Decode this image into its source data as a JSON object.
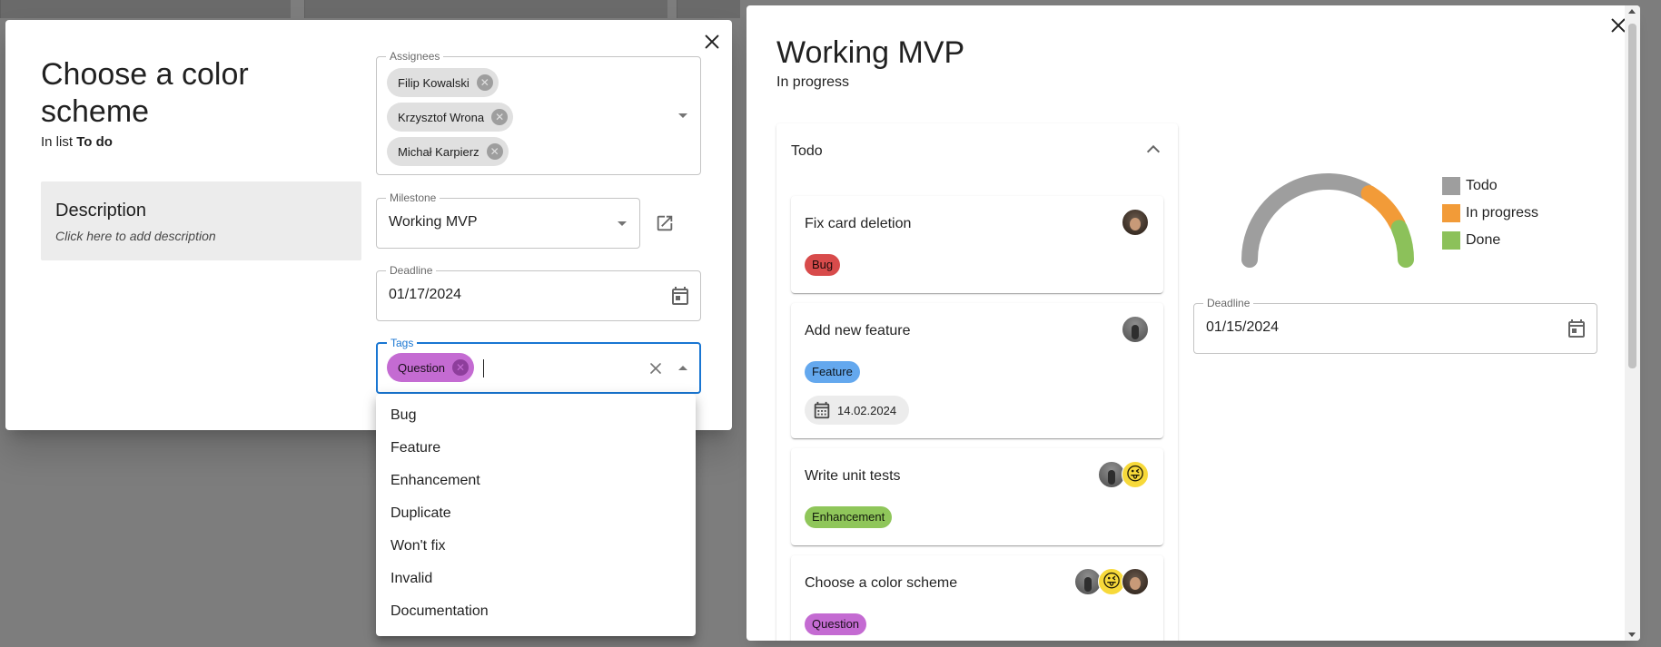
{
  "left_dialog": {
    "title": "Choose a color scheme",
    "in_list_prefix": "In list",
    "in_list_name": "To do",
    "description": {
      "title": "Description",
      "hint": "Click here to add description"
    },
    "assignees": {
      "label": "Assignees",
      "chips": [
        "Filip Kowalski",
        "Krzysztof Wrona",
        "Michał Karpierz"
      ]
    },
    "milestone": {
      "label": "Milestone",
      "value": "Working MVP"
    },
    "deadline": {
      "label": "Deadline",
      "value": "01/17/2024"
    },
    "tags": {
      "label": "Tags",
      "chips": [
        "Question"
      ],
      "options": [
        "Bug",
        "Feature",
        "Enhancement",
        "Duplicate",
        "Won't fix",
        "Invalid",
        "Documentation"
      ]
    }
  },
  "right_dialog": {
    "title": "Working MVP",
    "status": "In progress",
    "list": {
      "title": "Todo",
      "cards": [
        {
          "title": "Fix card deletion",
          "tag": "Bug",
          "tag_color": "#d84b4b"
        },
        {
          "title": "Add new feature",
          "tag": "Feature",
          "tag_color": "#64a8ee",
          "date": "14.02.2024"
        },
        {
          "title": "Write unit tests",
          "tag": "Enhancement",
          "tag_color": "#8fc65a"
        },
        {
          "title": "Choose a color scheme",
          "tag": "Question",
          "tag_color": "#c46bd2"
        }
      ]
    },
    "chart_data": {
      "type": "pie",
      "variant": "semi-donut gauge",
      "series": [
        {
          "name": "Todo",
          "value": 0.67,
          "color": "#9e9e9e"
        },
        {
          "name": "In progress",
          "value": 0.19,
          "color": "#f29b38"
        },
        {
          "name": "Done",
          "value": 0.14,
          "color": "#8cc15a"
        }
      ],
      "legend": "right"
    },
    "deadline": {
      "label": "Deadline",
      "value": "01/15/2024"
    }
  }
}
